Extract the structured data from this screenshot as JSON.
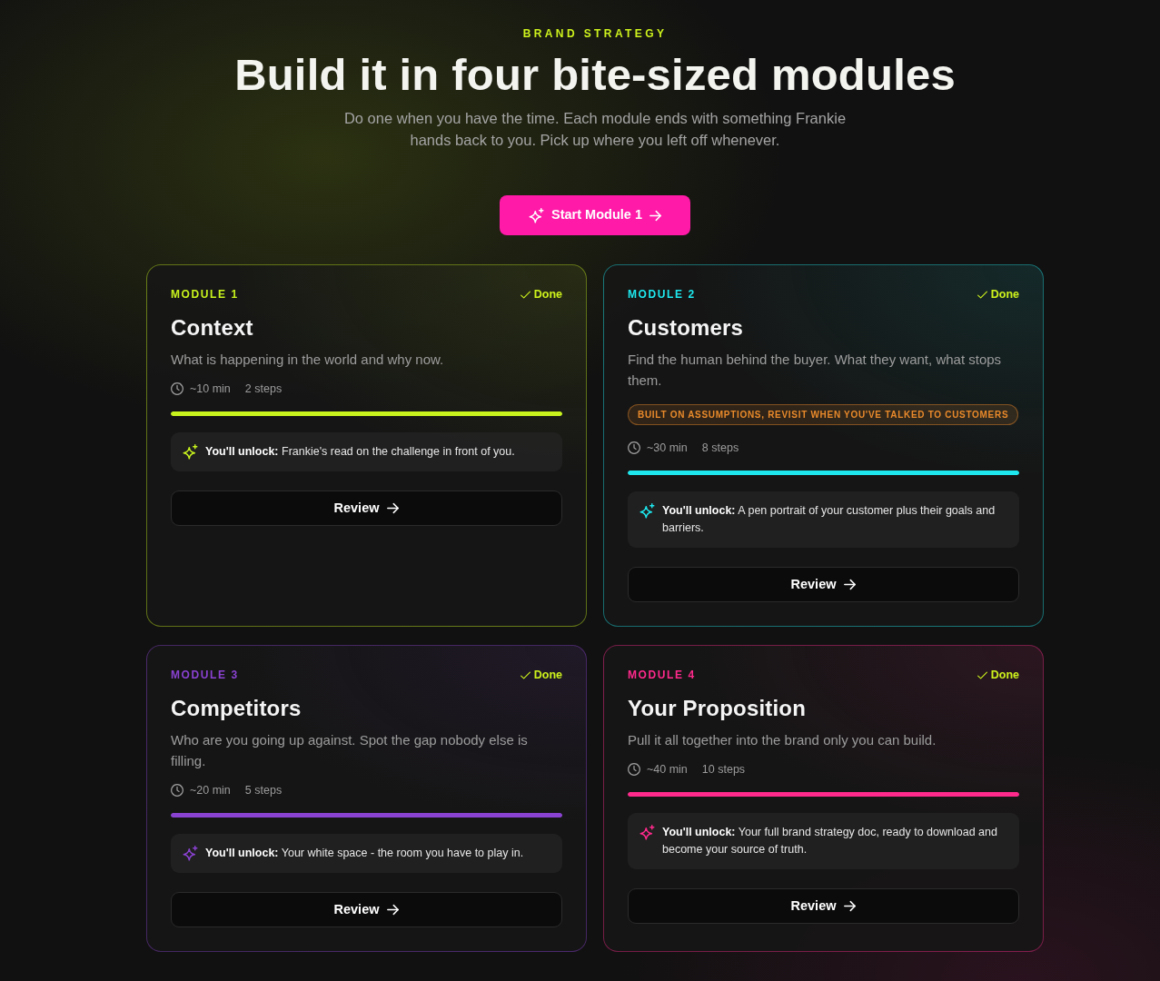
{
  "header": {
    "eyebrow": "BRAND STRATEGY",
    "title": "Build it in four bite-sized modules",
    "subtitle": "Do one when you have the time. Each module ends with something Frankie hands back to you. Pick up where you left off whenever.",
    "cta": {
      "label": "Start Module 1"
    }
  },
  "modules": [
    {
      "label": "MODULE 1",
      "color": "#c8f31d",
      "done": true,
      "status": "Done",
      "title": "Context",
      "description": "What is happening in the world and why now.",
      "duration": "~10 min",
      "steps": "2 steps",
      "level": 1,
      "unlock": "**You'll unlock:** Frankie's read on the challenge in front of you.",
      "action": "Review"
    },
    {
      "label": "MODULE 2",
      "color": "#1ee8ee",
      "done": true,
      "status": "Done",
      "title": "Customers",
      "description": "Find the human behind the buyer. What they want, what stops them.",
      "note": "BUILT ON ASSUMPTIONS, REVISIT WHEN YOU'VE TALKED TO CUSTOMERS",
      "duration": "~30 min",
      "steps": "8 steps",
      "level": 1,
      "unlock": "**You'll unlock:** A pen portrait of your customer plus their goals and barriers.",
      "action": "Review"
    },
    {
      "label": "MODULE 3",
      "color": "#8a42d2",
      "done": true,
      "status": "Done",
      "title": "Competitors",
      "description": "Who are you going up against. Spot the gap nobody else is filling.",
      "duration": "~20 min",
      "steps": "5 steps",
      "level": 1,
      "unlock": "**You'll unlock:** Your white space - the room you have to play in.",
      "action": "Review"
    },
    {
      "label": "MODULE 4",
      "color": "#ff2a8c",
      "done": true,
      "status": "Done",
      "title": "Your Proposition",
      "description": "Pull it all together into the brand only you can build.",
      "duration": "~40 min",
      "steps": "10 steps",
      "level": 1,
      "unlock": "**You'll unlock:** Your full brand strategy doc, ready to download and become your source of truth.",
      "action": "Review"
    }
  ]
}
